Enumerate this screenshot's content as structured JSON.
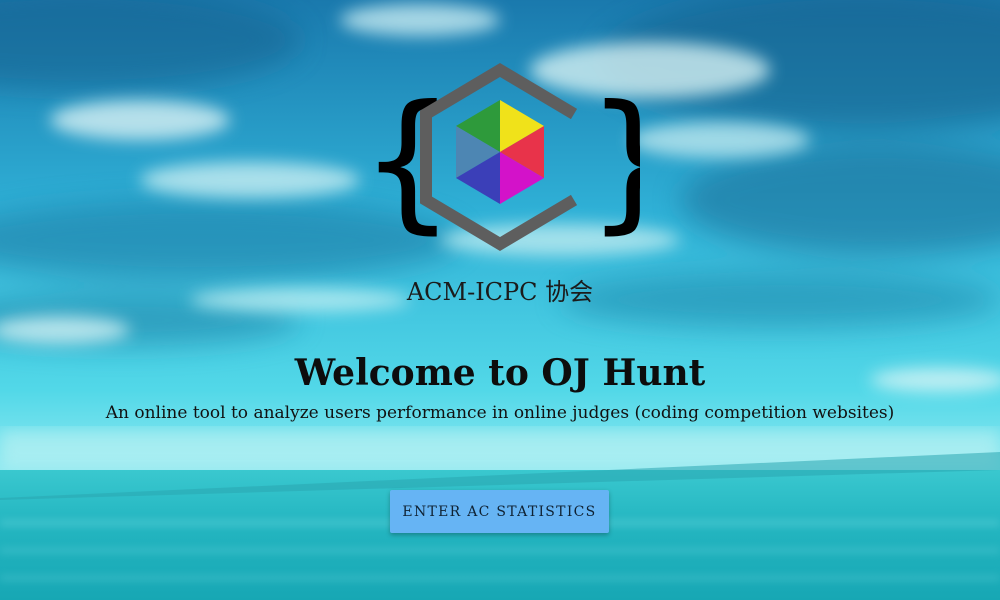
{
  "org": {
    "name": "ACM-ICPC 协会"
  },
  "hero": {
    "title": "Welcome to OJ Hunt",
    "subtitle": "An online tool to analyze users performance in online judges (coding competition websites)"
  },
  "cta": {
    "label": "ENTER AC STATISTICS"
  },
  "logo": {
    "icon": "cube-in-braces-logo"
  },
  "background": {
    "icon": "sky-and-sea-photo"
  },
  "colors": {
    "sky_top": "#1d7fb4",
    "sky_mid": "#3cc4dc",
    "sea": "#1fb3c2",
    "button": "#66b4f4",
    "logo_gray": "#5e5e5e"
  }
}
